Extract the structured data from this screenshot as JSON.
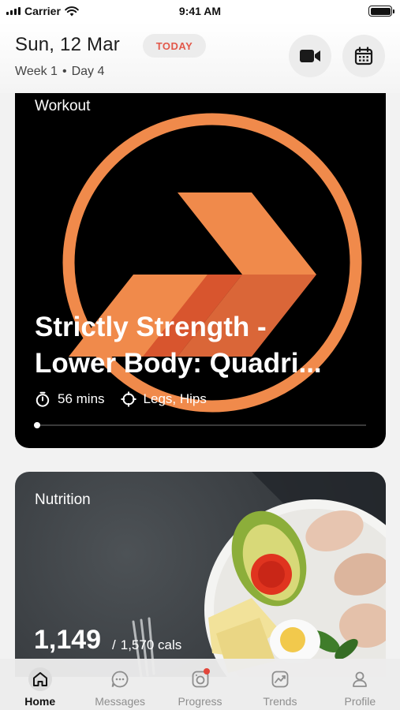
{
  "status_bar": {
    "carrier": "Carrier",
    "time": "9:41 AM"
  },
  "header": {
    "date": "Sun, 12 Mar",
    "today_badge": "TODAY",
    "week": "Week 1",
    "separator": "•",
    "day": "Day 4",
    "buttons": [
      {
        "icon": "video-camera-icon"
      },
      {
        "icon": "calendar-icon"
      }
    ]
  },
  "workout": {
    "label": "Workout",
    "title_line1": "Strictly Strength -",
    "title_line2": "Lower Body: Quadri...",
    "duration": "56 mins",
    "target": "Legs, Hips",
    "progress": 0.0,
    "accent_color": "#f08a4b",
    "accent_dark": "#d8552e"
  },
  "nutrition": {
    "label": "Nutrition",
    "calories": "1,149",
    "target": "1,570 cals"
  },
  "tabs": [
    {
      "label": "Home",
      "icon": "home-icon",
      "active": true
    },
    {
      "label": "Messages",
      "icon": "messages-icon",
      "active": false
    },
    {
      "label": "Progress",
      "icon": "progress-icon",
      "active": false,
      "notification": true
    },
    {
      "label": "Trends",
      "icon": "trends-icon",
      "active": false
    },
    {
      "label": "Profile",
      "icon": "profile-icon",
      "active": false
    }
  ]
}
